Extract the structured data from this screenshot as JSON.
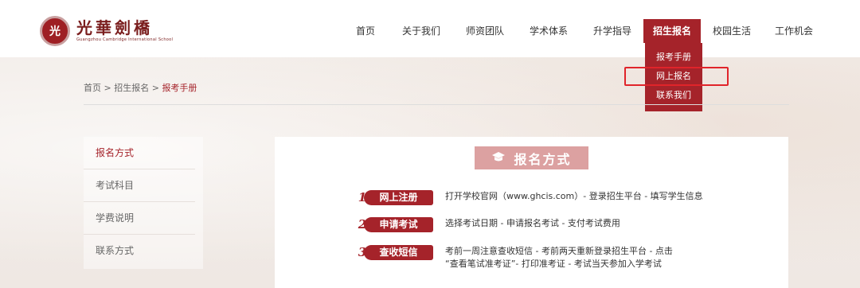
{
  "logo": {
    "seal": "光",
    "cn": "光華劍橋",
    "en": "Guangzhou Cambridge International School"
  },
  "nav": {
    "items": [
      {
        "label": "首页"
      },
      {
        "label": "关于我们"
      },
      {
        "label": "师资团队"
      },
      {
        "label": "学术体系"
      },
      {
        "label": "升学指导"
      },
      {
        "label": "招生报名"
      },
      {
        "label": "校园生活"
      },
      {
        "label": "工作机会"
      }
    ],
    "dropdown": [
      "报考手册",
      "网上报名",
      "联系我们"
    ]
  },
  "breadcrumb": {
    "home": "首页",
    "sep1": ">",
    "section": "招生报名",
    "sep2": ">",
    "current": "报考手册"
  },
  "sidebar": {
    "items": [
      "报名方式",
      "考试科目",
      "学费说明",
      "联系方式"
    ]
  },
  "main": {
    "title": "报名方式",
    "steps": [
      {
        "num": "1",
        "label": "网上注册",
        "text": "打开学校官网（www.ghcis.com）- 登录招生平台 - 填写学生信息"
      },
      {
        "num": "2",
        "label": "申请考试",
        "text": "选择考试日期 - 申请报名考试 - 支付考试费用"
      },
      {
        "num": "3",
        "label": "查收短信",
        "text": "考前一周注意查收短信 - 考前两天重新登录招生平台 - 点击",
        "text2": "“查看笔试准考证”- 打印准考证 - 考试当天参加入学考试"
      }
    ]
  },
  "colors": {
    "brand": "#a5232a",
    "title_bg": "#dca1a1",
    "highlight": "#e0242a"
  }
}
